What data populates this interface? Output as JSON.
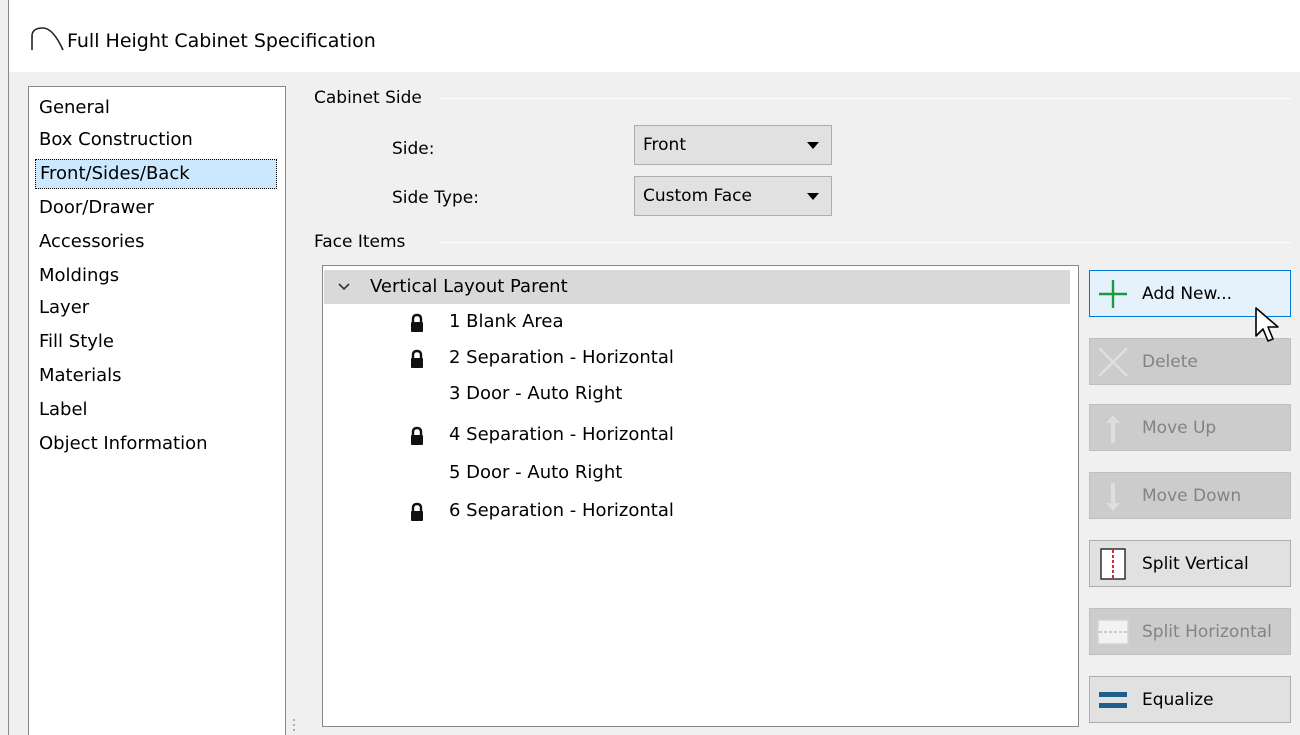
{
  "window": {
    "title": "Full Height Cabinet Specification"
  },
  "sidebar": {
    "items": [
      {
        "label": "General",
        "selected": false
      },
      {
        "label": "Box Construction",
        "selected": false
      },
      {
        "label": "Front/Sides/Back",
        "selected": true
      },
      {
        "label": "Door/Drawer",
        "selected": false
      },
      {
        "label": "Accessories",
        "selected": false
      },
      {
        "label": "Moldings",
        "selected": false
      },
      {
        "label": "Layer",
        "selected": false
      },
      {
        "label": "Fill Style",
        "selected": false
      },
      {
        "label": "Materials",
        "selected": false
      },
      {
        "label": "Label",
        "selected": false
      },
      {
        "label": "Object Information",
        "selected": false
      }
    ]
  },
  "cabinet_side": {
    "group_title": "Cabinet Side",
    "side_label": "Side:",
    "side_value": "Front",
    "side_type_label": "Side Type:",
    "side_type_value": "Custom Face"
  },
  "face_items": {
    "group_title": "Face Items",
    "parent": {
      "label": "Vertical Layout Parent",
      "expanded": true
    },
    "children": [
      {
        "label": "1 Blank Area",
        "locked": true
      },
      {
        "label": "2 Separation - Horizontal",
        "locked": true
      },
      {
        "label": "3 Door - Auto Right",
        "locked": false
      },
      {
        "label": "4 Separation - Horizontal",
        "locked": true
      },
      {
        "label": "5 Door - Auto Right",
        "locked": false
      },
      {
        "label": "6 Separation - Horizontal",
        "locked": true
      }
    ]
  },
  "buttons": {
    "add_new": "Add New...",
    "delete": "Delete",
    "move_up": "Move Up",
    "move_down": "Move Down",
    "split_vertical": "Split Vertical",
    "split_horizontal": "Split Horizontal",
    "equalize": "Equalize"
  },
  "colors": {
    "selection": "#cce8ff",
    "focus_border": "#0078d7",
    "add_icon": "#1c9b3c",
    "equalize_icon": "#1e5f8c",
    "split_icon": "#d0302a"
  }
}
